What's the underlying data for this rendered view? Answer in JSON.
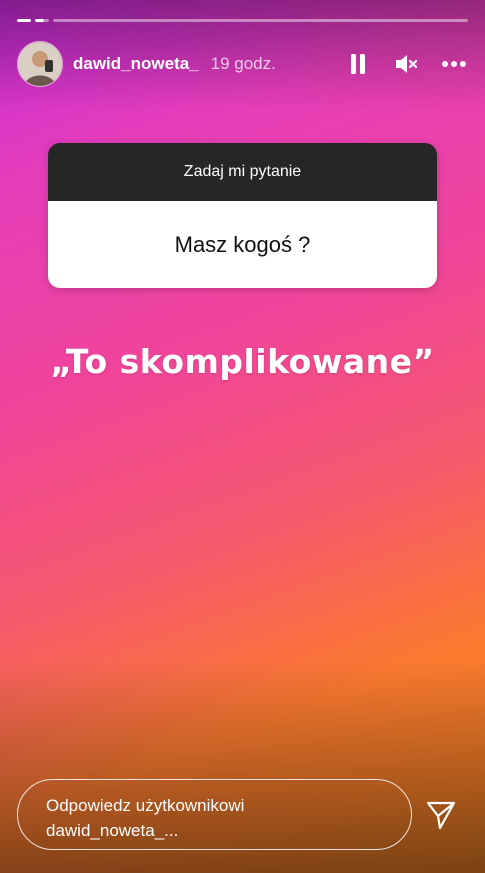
{
  "story": {
    "progress_segments": [
      {
        "state": "done"
      },
      {
        "state": "current"
      },
      {
        "state": "pending"
      }
    ]
  },
  "header": {
    "username": "dawid_noweta_",
    "time_ago": "19 godz.",
    "controls": [
      "pause-icon",
      "muted-speaker-icon",
      "more-options-icon"
    ]
  },
  "question_card": {
    "title": "Zadaj mi pytanie",
    "question": "Masz kogoś ?"
  },
  "answer_text": "„To skomplikowane”",
  "reply": {
    "placeholder_line1": "Odpowiedz użytkownikowi",
    "placeholder_line2": "dawid_noweta_..."
  },
  "colors": {
    "gradient_start": "#c62bdc",
    "gradient_mid": "#f0459a",
    "gradient_end": "#fb7a2e",
    "card_header": "#262626"
  }
}
